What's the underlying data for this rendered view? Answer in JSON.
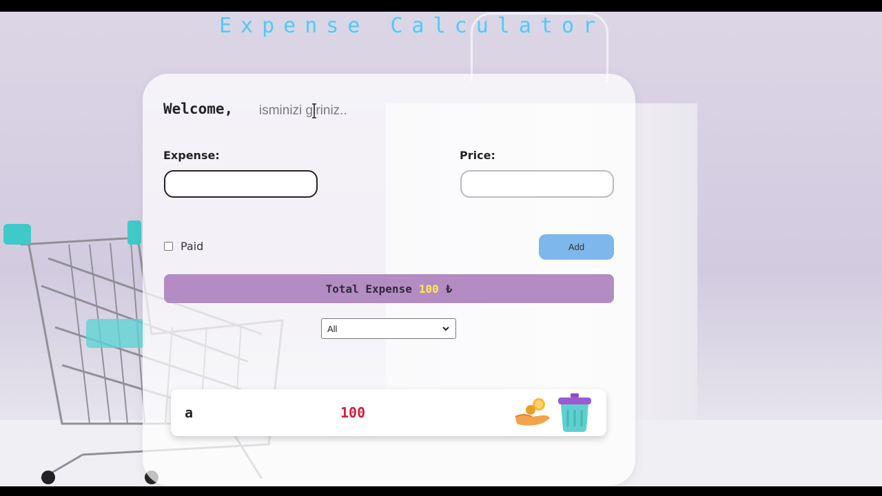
{
  "app": {
    "title": "Expense Calculator"
  },
  "welcome": {
    "label": "Welcome,",
    "name_placeholder": "isminizi giriniz.."
  },
  "form": {
    "expense_label": "Expense:",
    "expense_value": "",
    "price_label": "Price:",
    "price_value": "",
    "paid_label": "Paid",
    "paid_checked": false,
    "add_label": "Add"
  },
  "total": {
    "label": "Total Expense",
    "value": "100",
    "currency": "₺"
  },
  "filter": {
    "selected": "All"
  },
  "expenses": [
    {
      "name": "a",
      "price": "100",
      "pay_icon": "coin-hand-icon",
      "delete_icon": "trash-bin-icon"
    }
  ],
  "colors": {
    "title": "#5ec4ee",
    "total_bar": "#b48cc4",
    "total_value": "#ffe94d",
    "add_button": "#7db7ec",
    "price_text": "#d11f3a"
  }
}
